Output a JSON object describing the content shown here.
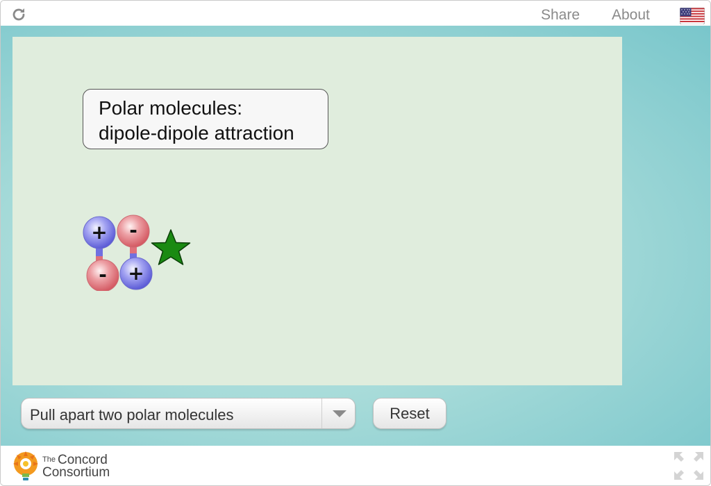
{
  "header": {
    "reload_icon": "reload-icon",
    "share_label": "Share",
    "about_label": "About",
    "flag_icon": "us-flag-icon"
  },
  "simulation": {
    "caption_line1": "Polar molecules:",
    "caption_line2": "dipole-dipole attraction",
    "molecules": {
      "positive_sign": "+",
      "negative_sign": "-",
      "positive_color": "#7b7bea",
      "negative_color": "#e2838a"
    },
    "star_color": "#1a8a12",
    "background_color": "#e0eddd"
  },
  "controls": {
    "dropdown_value": "Pull apart two polar molecules",
    "reset_label": "Reset"
  },
  "footer": {
    "logo_the": "The",
    "logo_concord": "Concord",
    "logo_consortium": "Consortium",
    "fullscreen_icon": "fullscreen-icon"
  }
}
